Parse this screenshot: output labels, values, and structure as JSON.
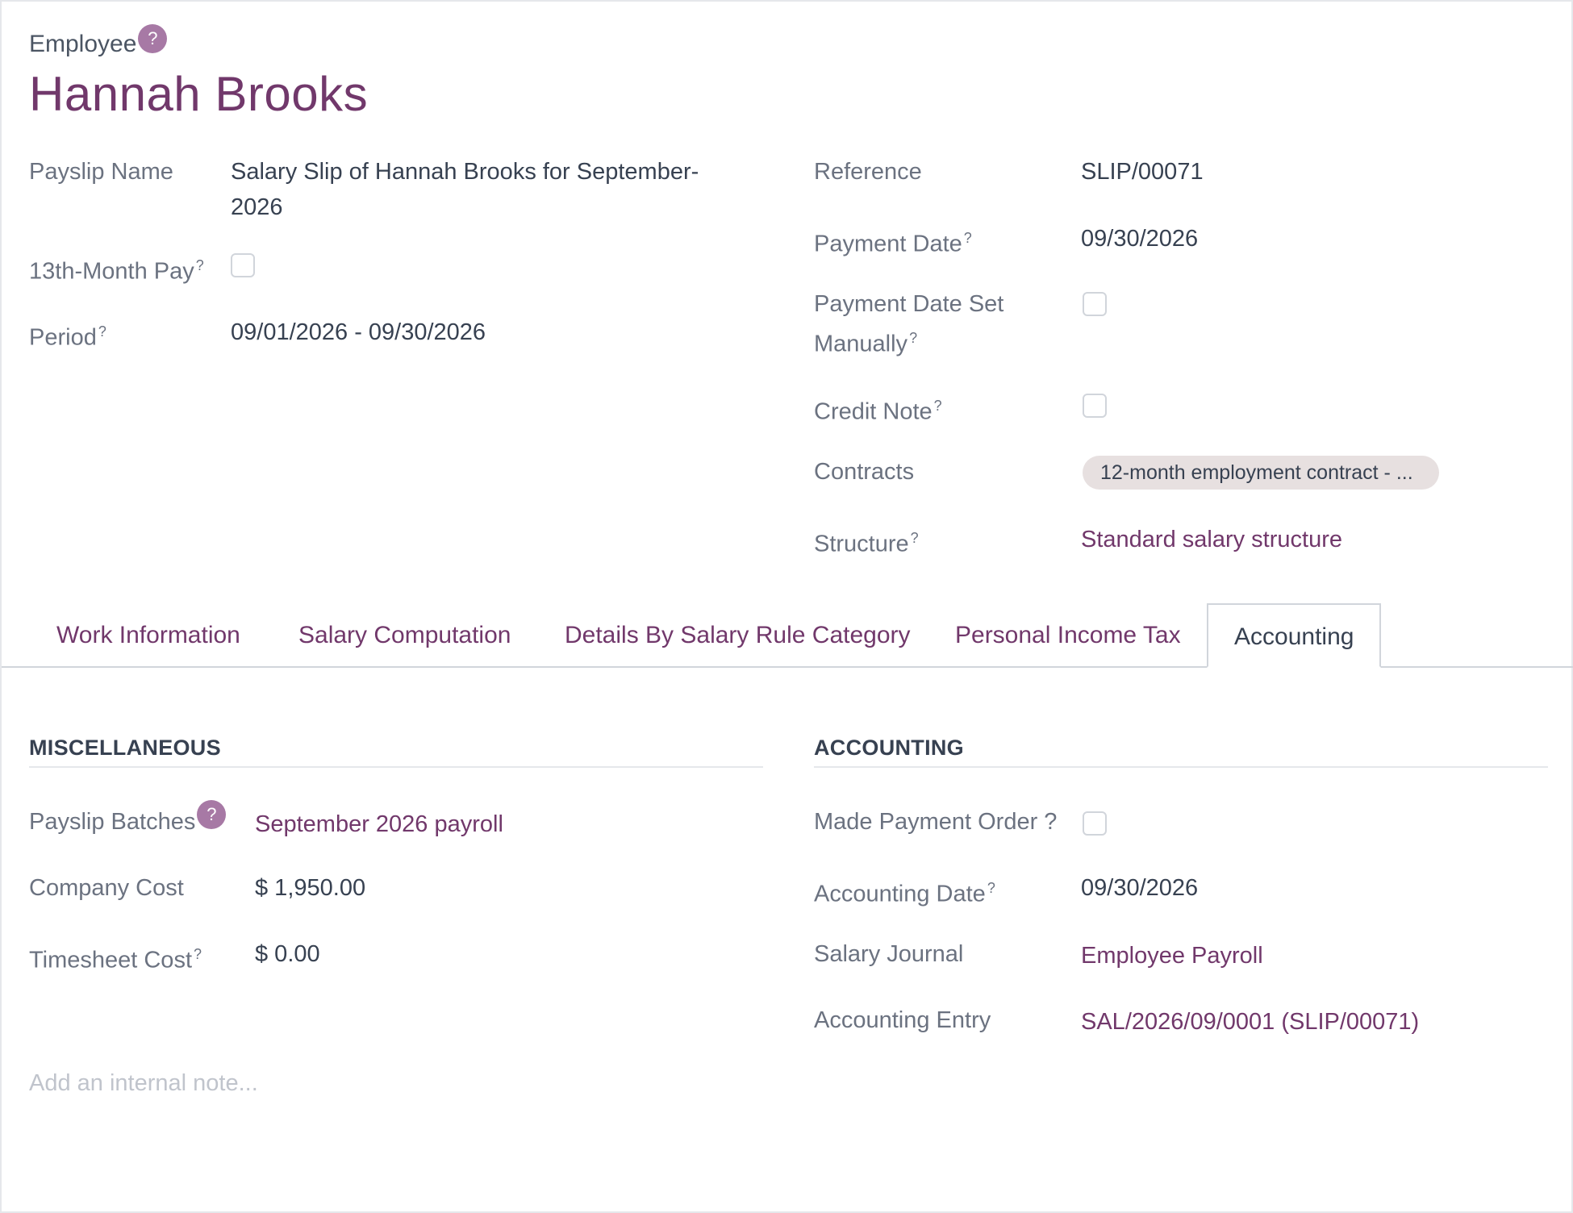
{
  "header": {
    "employee_label": "Employee",
    "help_mark": "?",
    "employee_name": "Hannah Brooks"
  },
  "left_fields": {
    "payslip_name_label": "Payslip Name",
    "payslip_name_line1": "Salary Slip of Hannah Brooks for September-",
    "payslip_name_line2": "2026",
    "thirteenth_label": "13th-Month Pay",
    "period_label": "Period",
    "period_value": "09/01/2026 - 09/30/2026"
  },
  "right_fields": {
    "reference_label": "Reference",
    "reference_value": "SLIP/00071",
    "payment_date_label": "Payment Date",
    "payment_date_value": "09/30/2026",
    "payment_date_manual_line1": "Payment Date Set",
    "payment_date_manual_line2": "Manually",
    "credit_note_label": "Credit Note",
    "contracts_label": "Contracts",
    "contracts_value": "12-month employment contract - ...",
    "structure_label": "Structure",
    "structure_value": "Standard salary structure"
  },
  "tooltip_mark": "?",
  "tabs": [
    {
      "label": "Work Information"
    },
    {
      "label": "Salary Computation"
    },
    {
      "label": "Details By Salary Rule Category"
    },
    {
      "label": "Personal Income Tax"
    },
    {
      "label": "Accounting"
    }
  ],
  "misc": {
    "title": "MISCELLANEOUS",
    "payslip_batches_label": "Payslip Batches",
    "payslip_batches_value": "September 2026 payroll",
    "company_cost_label": "Company Cost",
    "company_cost_value": "$ 1,950.00",
    "timesheet_cost_label": "Timesheet Cost",
    "timesheet_cost_value": "$ 0.00"
  },
  "accounting": {
    "title": "ACCOUNTING",
    "made_payment_order_label": "Made Payment Order ?",
    "accounting_date_label": "Accounting Date",
    "accounting_date_value": "09/30/2026",
    "salary_journal_label": "Salary Journal",
    "salary_journal_value": "Employee Payroll",
    "accounting_entry_label": "Accounting Entry",
    "accounting_entry_value": "SAL/2026/09/0001 (SLIP/00071)"
  },
  "note": {
    "placeholder": "Add an internal note..."
  },
  "colors": {
    "accent": "#71386b",
    "help_badge": "#a779a5"
  }
}
